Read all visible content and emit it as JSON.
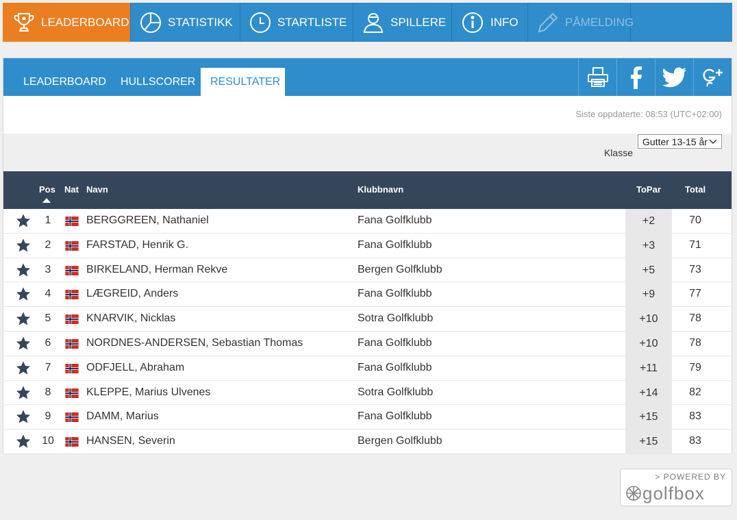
{
  "topnav": {
    "tabs": [
      {
        "label": "LEADERBOARD",
        "icon": "trophy-icon",
        "active": true
      },
      {
        "label": "STATISTIKK",
        "icon": "pie-chart-icon"
      },
      {
        "label": "STARTLISTE",
        "icon": "clock-icon"
      },
      {
        "label": "SPILLERE",
        "icon": "person-icon"
      },
      {
        "label": "INFO",
        "icon": "info-icon"
      },
      {
        "label": "PÅMELDING",
        "icon": "pencil-icon",
        "disabled": true
      }
    ]
  },
  "subnav": {
    "tabs": [
      {
        "label": "LEADERBOARD"
      },
      {
        "label": "HULLSCORER"
      },
      {
        "label": "RESULTATER",
        "active": true
      }
    ],
    "share": [
      "print-icon",
      "facebook-icon",
      "twitter-icon",
      "google-plus-icon"
    ]
  },
  "updated": "Siste oppdaterte: 08:53 (UTC+02:00)",
  "filter": {
    "klasse_label": "Klasse",
    "klasse_value": "Gutter 13-15 år"
  },
  "table": {
    "headers": {
      "pos": "Pos",
      "nat": "Nat",
      "name": "Navn",
      "club": "Klubbnavn",
      "topar": "ToPar",
      "total": "Total"
    },
    "rows": [
      {
        "pos": "1",
        "name": "BERGGREEN, Nathaniel",
        "club": "Fana Golfklubb",
        "topar": "+2",
        "total": "70"
      },
      {
        "pos": "2",
        "name": "FARSTAD, Henrik G.",
        "club": "Fana Golfklubb",
        "topar": "+3",
        "total": "71"
      },
      {
        "pos": "3",
        "name": "BIRKELAND, Herman Rekve",
        "club": "Bergen Golfklubb",
        "topar": "+5",
        "total": "73"
      },
      {
        "pos": "4",
        "name": "LÆGREID, Anders",
        "club": "Fana Golfklubb",
        "topar": "+9",
        "total": "77"
      },
      {
        "pos": "5",
        "name": "KNARVIK, Nicklas",
        "club": "Sotra Golfklubb",
        "topar": "+10",
        "total": "78"
      },
      {
        "pos": "6",
        "name": "NORDNES-ANDERSEN, Sebastian Thomas",
        "club": "Fana Golfklubb",
        "topar": "+10",
        "total": "78"
      },
      {
        "pos": "7",
        "name": "ODFJELL, Abraham",
        "club": "Fana Golfklubb",
        "topar": "+11",
        "total": "79"
      },
      {
        "pos": "8",
        "name": "KLEPPE, Marius Ulvenes",
        "club": "Sotra Golfklubb",
        "topar": "+14",
        "total": "82"
      },
      {
        "pos": "9",
        "name": "DAMM, Marius",
        "club": "Fana Golfklubb",
        "topar": "+15",
        "total": "83"
      },
      {
        "pos": "10",
        "name": "HANSEN, Severin",
        "club": "Bergen Golfklubb",
        "topar": "+15",
        "total": "83"
      }
    ]
  },
  "powered": {
    "label": "> POWERED BY",
    "logo": "golfbox"
  },
  "colors": {
    "blue": "#2f8dcb",
    "orange": "#ec7e22",
    "header": "#36465a",
    "star": "#36465a"
  }
}
